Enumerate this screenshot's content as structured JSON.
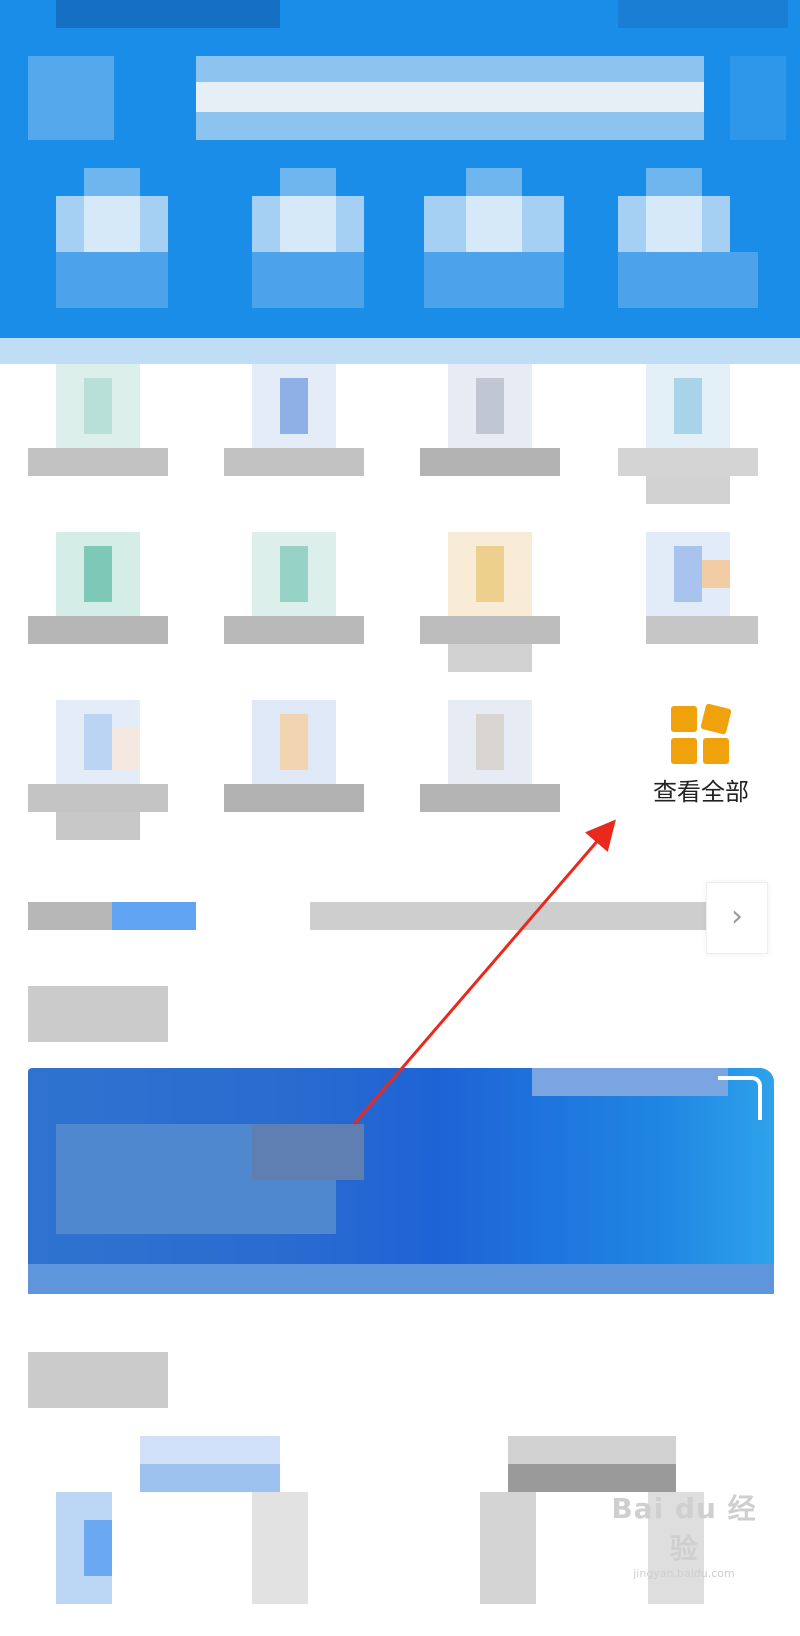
{
  "view_all": {
    "label": "查看全部",
    "icon": "grid-apps-icon",
    "icon_color": "#efa20c"
  },
  "notice": {
    "chevron": "›"
  },
  "watermark": {
    "brand": "Bai du 经验",
    "url": "jingyan.baidu.com"
  },
  "colors": {
    "header": "#1a8de8",
    "banner": "#2a6bd0",
    "annotation_arrow": "#e8291c"
  }
}
